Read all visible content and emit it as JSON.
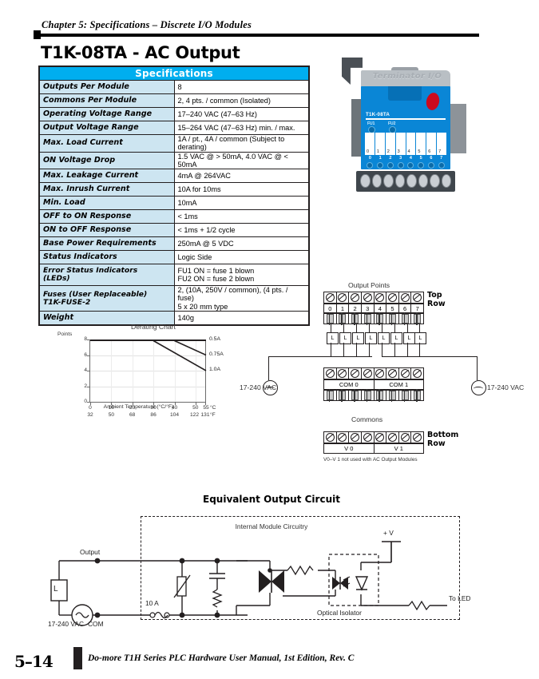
{
  "header": {
    "chapter": "Chapter 5: Specifications – Discrete I/O Modules",
    "module_title": "T1K-08TA - AC Output"
  },
  "spec_table": {
    "title": "Specifications",
    "rows": [
      {
        "key": "Outputs Per Module",
        "value": "8"
      },
      {
        "key": "Commons Per Module",
        "value": "2, 4 pts. / common (Isolated)"
      },
      {
        "key": "Operating Voltage Range",
        "value": "17–240 VAC (47–63 Hz)"
      },
      {
        "key": "Output Voltage Range",
        "value": "15–264 VAC (47–63 Hz) min. / max."
      },
      {
        "key": "Max.  Load Current",
        "value": "1A / pt., 4A / common (Subject to derating)"
      },
      {
        "key": "ON Voltage Drop",
        "value": "1.5 VAC @ > 50mA, 4.0 VAC @ < 50mA"
      },
      {
        "key": "Max.  Leakage Current",
        "value": "4mA @ 264VAC"
      },
      {
        "key": "Max.  Inrush Current",
        "value": "10A for 10ms"
      },
      {
        "key": "Min.  Load",
        "value": "10mA"
      },
      {
        "key": "OFF to ON Response",
        "value": "< 1ms"
      },
      {
        "key": "ON to OFF Response",
        "value": "< 1ms + 1/2 cycle"
      },
      {
        "key": "Base Power Requirements",
        "value": "250mA @ 5 VDC"
      },
      {
        "key": "Status Indicators",
        "value": "Logic Side"
      }
    ],
    "error_status": {
      "key_line1": "Error Status Indicators",
      "key_line2": "(LEDs)",
      "value_line1": "FU1 ON = fuse 1 blown",
      "value_line2": "FU2 ON = fuse 2 blown"
    },
    "fuses": {
      "key_line1": "Fuses (User Replaceable)",
      "key_line2": "T1K-FUSE-2",
      "value_line1": "2, (10A, 250V / common), (4 pts. / fuse)",
      "value_line2": "5 x 20 mm type"
    },
    "weight": {
      "key": "Weight",
      "value": "140g"
    }
  },
  "photo": {
    "brand_text": "Terminator I/O",
    "part_number": "T1K-08TA",
    "fuse_leds": [
      "FU1",
      "FU2"
    ],
    "point_numbers": [
      "0",
      "1",
      "2",
      "3",
      "4",
      "5",
      "6",
      "7"
    ]
  },
  "chart_data": {
    "type": "line",
    "title": "Derating Chart",
    "ylabel": "Points",
    "xlabel": "Ambient Temperature (°C/°F)",
    "ylim": [
      0,
      8
    ],
    "yticks": [
      "0",
      "2",
      "4",
      "6",
      "8"
    ],
    "xticks_c": [
      "0",
      "10",
      "20",
      "30",
      "40",
      "50",
      "55"
    ],
    "xticks_f": [
      "32",
      "50",
      "68",
      "86",
      "104",
      "122",
      "131"
    ],
    "x_unit_c": "°C",
    "x_unit_f": "°F",
    "xlim": [
      0,
      55
    ],
    "grid": true,
    "legend_position": "right-inline",
    "series": [
      {
        "name": "0.5A",
        "x": [
          0,
          55
        ],
        "y": [
          8,
          8
        ]
      },
      {
        "name": "0.75A",
        "x": [
          0,
          40,
          55
        ],
        "y": [
          8,
          8,
          6
        ]
      },
      {
        "name": "1.0A",
        "x": [
          0,
          30,
          55
        ],
        "y": [
          8,
          8,
          4
        ]
      }
    ]
  },
  "wiring": {
    "output_points_label": "Output Points",
    "top_row_label": "Top\nRow",
    "top_row_line1": "Top",
    "top_row_line2": "Row",
    "bottom_row_line1": "Bottom",
    "bottom_row_line2": "Row",
    "point_numbers": [
      "0",
      "1",
      "2",
      "3",
      "4",
      "5",
      "6",
      "7"
    ],
    "load_label": "L",
    "commons_label": "Commons",
    "com0": "COM 0",
    "com1": "COM 1",
    "v0": "V 0",
    "v1": "V 1",
    "supply_left": "17-240 VAC",
    "supply_right": "17-240 VAC",
    "note": "V0–V 1 not used with AC Output Modules"
  },
  "equivalent_circuit": {
    "title": "Equivalent Output Circuit",
    "internal_label": "Internal Module Circuitry",
    "output_label": "Output",
    "com_label": "COM",
    "supply_label": "17-240 VAC",
    "fuse_label": "10 A",
    "load_label": "L",
    "plus_v": "+ V",
    "optical_isolator": "Optical Isolator",
    "to_led": "To LED"
  },
  "footer": {
    "page_number": "5–14",
    "text": "Do-more T1H Series PLC Hardware User Manual, 1st Edition, Rev. C"
  },
  "colors": {
    "accent_cyan": "#00AEEF",
    "table_key_bg": "#CDE5F1",
    "module_blue": "#0A86D6",
    "ink": "#231F20"
  }
}
